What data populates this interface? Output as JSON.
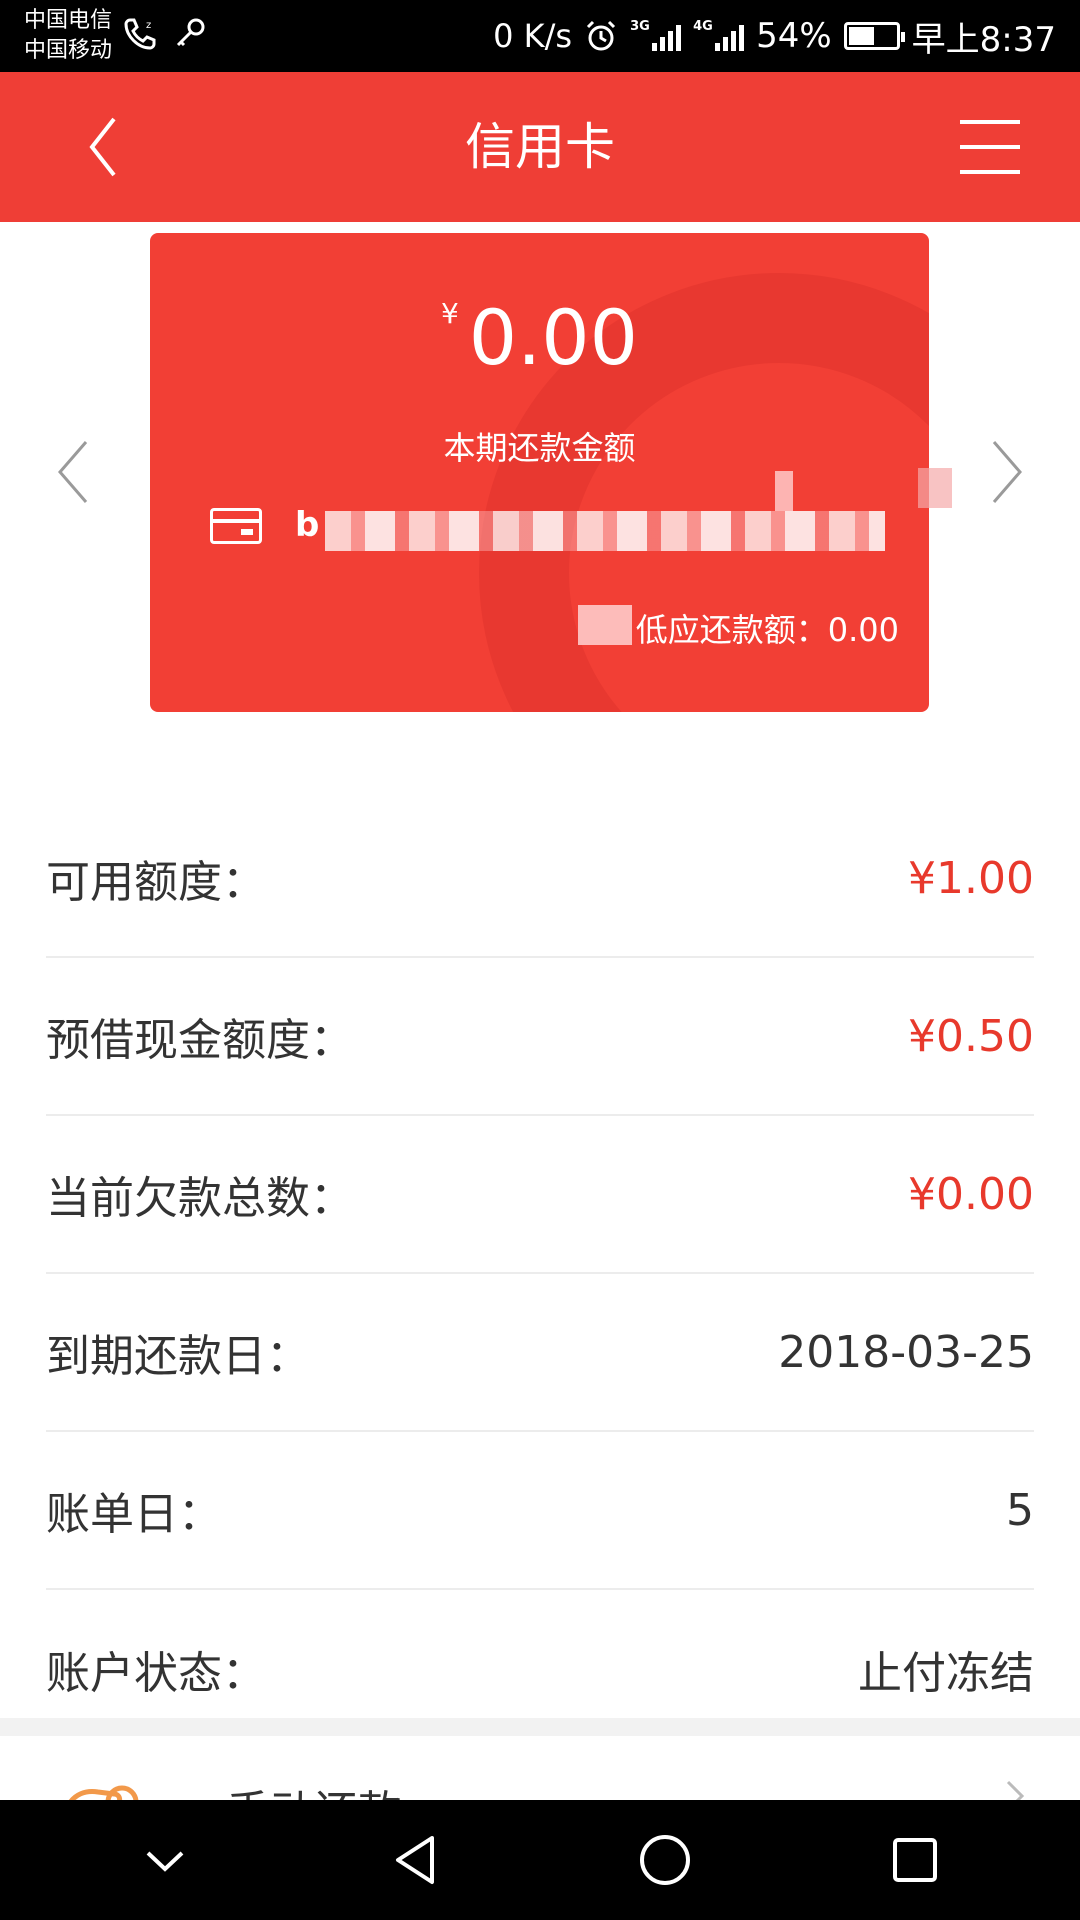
{
  "status_bar": {
    "carrier_1": "中国电信",
    "carrier_2": "中国移动",
    "speed": "0 K/s",
    "network_1": "3G",
    "network_2": "4G",
    "battery": "54%",
    "battery_level": 0.54,
    "time": "早上8:37"
  },
  "header": {
    "title": "信用卡"
  },
  "card": {
    "currency_symbol": "¥",
    "amount": "0.00",
    "amount_label": "本期还款金额",
    "card_number_visible": "b",
    "min_payment_label": "低应还款额：",
    "min_payment_value": "0.00"
  },
  "details": [
    {
      "label": "可用额度：",
      "value": "¥1.00"
    },
    {
      "label": "预借现金额度：",
      "value": "¥0.50"
    },
    {
      "label": "当前欠款总数：",
      "value": "¥0.00"
    },
    {
      "label": "到期还款日：",
      "value": "2018-03-25"
    },
    {
      "label": "账单日：",
      "value": "5"
    },
    {
      "label": "账户状态：",
      "value": "止付冻结"
    }
  ],
  "repay": {
    "label": "手动还款"
  },
  "colors": {
    "brand": "#ef3e36",
    "card": "#f23f35",
    "value_red": "#e8392c",
    "icon_orange": "#f2994a"
  }
}
